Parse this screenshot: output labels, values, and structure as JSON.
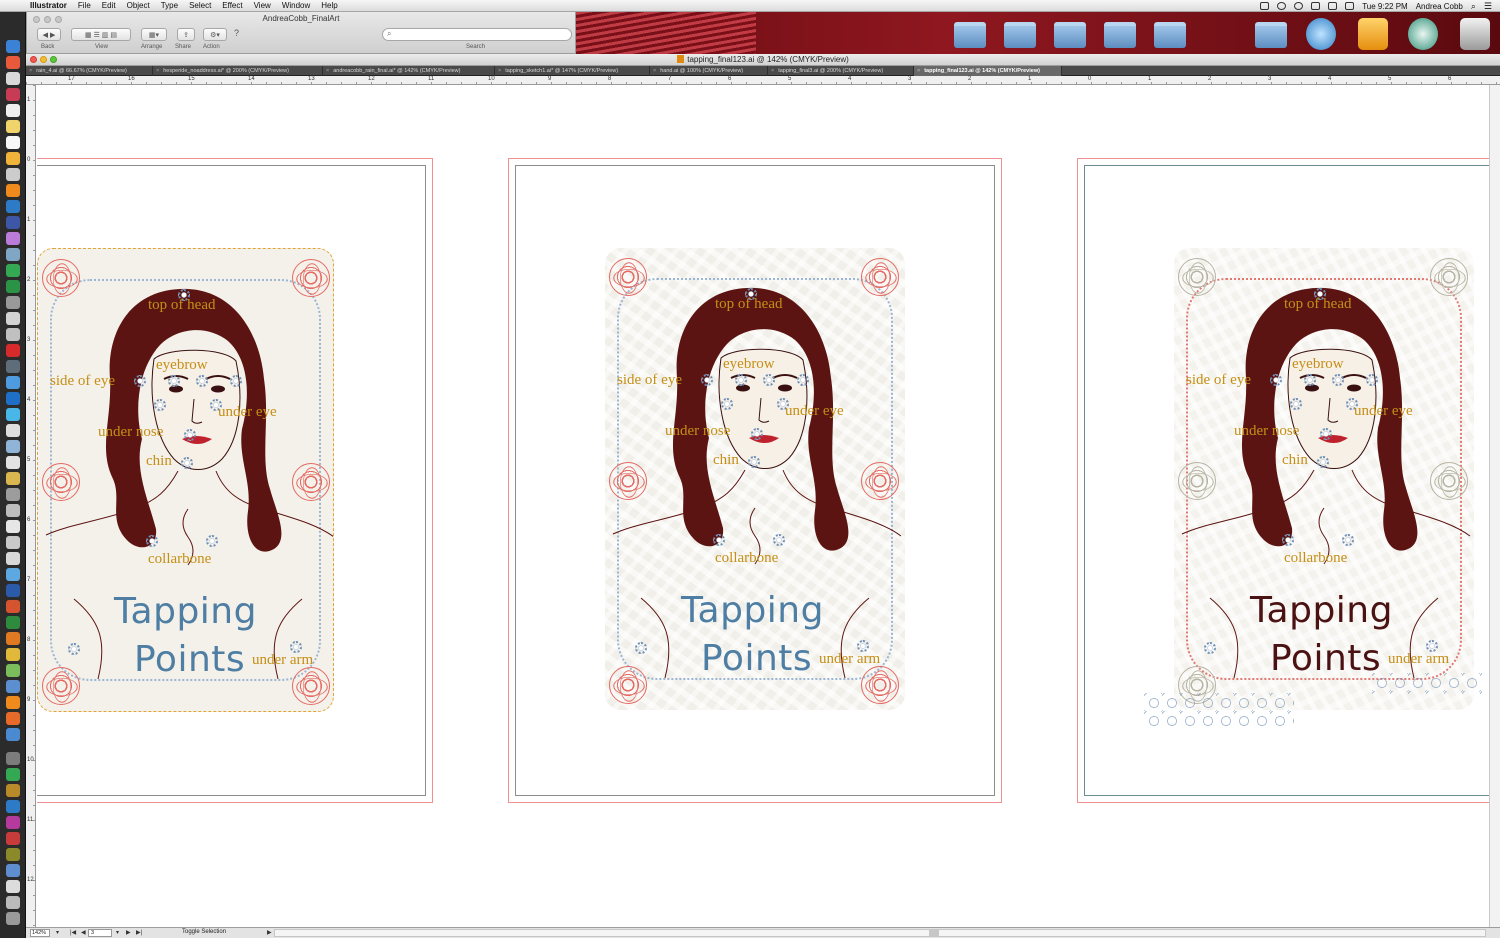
{
  "menubar": {
    "app_name": "Illustrator",
    "items": [
      "File",
      "Edit",
      "Object",
      "Type",
      "Select",
      "Effect",
      "View",
      "Window",
      "Help"
    ],
    "clock": "Tue 9:22 PM",
    "user": "Andrea Cobb"
  },
  "finder": {
    "title": "AndreaCobb_FinalArt",
    "back_label": "Back",
    "view_label": "View",
    "arrange_label": "Arrange",
    "share_label": "Share",
    "action_label": "Action",
    "help_glyph": "?",
    "search_label": "Search"
  },
  "document": {
    "window_title": "tapping_final123.ai @ 142% (CMYK/Preview)",
    "tabs": [
      {
        "label": "rain_4.ai @ 66.67% (CMYK/Preview)",
        "active": false
      },
      {
        "label": "hesperide_noaddress.ai* @ 200% (CMYK/Preview)",
        "active": false
      },
      {
        "label": "andreacobb_rain_final.ai* @ 142% (CMYK/Preview)",
        "active": false
      },
      {
        "label": "tapping_sketch1.ai* @ 147% (CMYK/Preview)",
        "active": false
      },
      {
        "label": "hand.ai @ 100% (CMYK/Preview)",
        "active": false
      },
      {
        "label": "tapping_final3.ai @ 200% (CMYK/Preview)",
        "active": false
      },
      {
        "label": "tapping_final123.ai @ 142% (CMYK/Preview)",
        "active": true
      }
    ],
    "hruler_numbers": [
      "17",
      "16",
      "15",
      "14",
      "13",
      "12",
      "11",
      "10",
      "9",
      "8",
      "7",
      "6",
      "5",
      "4",
      "3",
      "2",
      "1",
      "0",
      "1",
      "2",
      "3",
      "4",
      "5",
      "6"
    ],
    "vruler_numbers": [
      "1",
      "0",
      "1",
      "2",
      "3",
      "4",
      "5",
      "6",
      "7",
      "8",
      "9",
      "10",
      "11",
      "12"
    ],
    "status": {
      "zoom": "142%",
      "artboard_number": "3",
      "toggle_label": "Toggle Selection"
    }
  },
  "cards": [
    {
      "title_line1": "Tapping",
      "title_line2": "Points",
      "title_color": "#4e7ea3",
      "labels": {
        "top_of_head": "top of head",
        "eyebrow": "eyebrow",
        "side_of_eye": "side of eye",
        "under_eye": "under eye",
        "under_nose": "under nose",
        "chin": "chin",
        "collarbone": "collarbone",
        "under_arm": "under arm"
      }
    },
    {
      "title_line1": "Tapping",
      "title_line2": "Points",
      "title_color": "#4e7ea3",
      "labels": {
        "top_of_head": "top of head",
        "eyebrow": "eyebrow",
        "side_of_eye": "side of eye",
        "under_eye": "under eye",
        "under_nose": "under nose",
        "chin": "chin",
        "collarbone": "collarbone",
        "under_arm": "under arm"
      }
    },
    {
      "title_line1": "Tapping",
      "title_line2": "Points",
      "title_color": "#4a1212",
      "labels": {
        "top_of_head": "top of head",
        "eyebrow": "eyebrow",
        "side_of_eye": "side of eye",
        "under_eye": "under eye",
        "under_nose": "under nose",
        "chin": "chin",
        "collarbone": "collarbone",
        "under_arm": "under arm"
      }
    }
  ],
  "colors": {
    "hair": "#5c1412",
    "lips": "#c0222d",
    "label_gold": "#c58f16",
    "artboard_border": "#ef8f8f"
  }
}
